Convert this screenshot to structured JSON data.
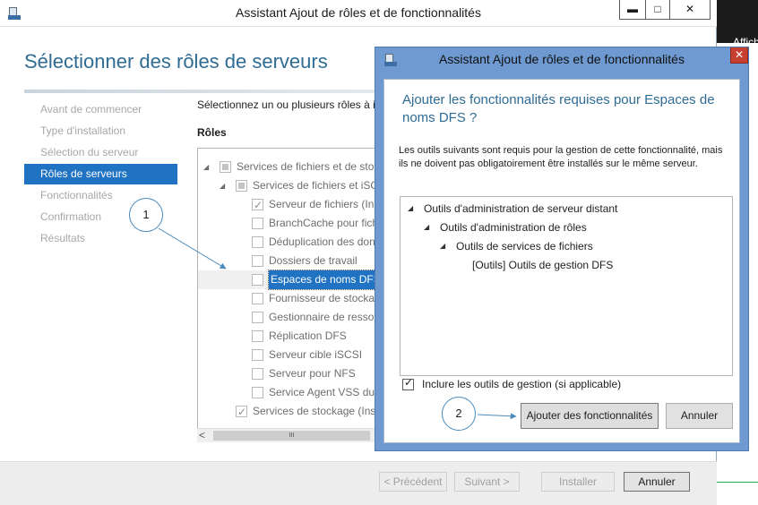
{
  "main_window": {
    "title": "Assistant Ajout de rôles et de fonctionnalités",
    "heading": "Sélectionner des rôles de serveurs",
    "nav": [
      {
        "label": "Avant de commencer",
        "active": false
      },
      {
        "label": "Type d'installation",
        "active": false
      },
      {
        "label": "Sélection du serveur",
        "active": false
      },
      {
        "label": "Rôles de serveurs",
        "active": true
      },
      {
        "label": "Fonctionnalités",
        "active": false
      },
      {
        "label": "Confirmation",
        "active": false
      },
      {
        "label": "Résultats",
        "active": false
      }
    ],
    "instruction": "Sélectionnez un ou plusieurs rôles à i",
    "roles_label": "Rôles",
    "roles_tree": [
      {
        "label": "Services de fichiers et de stoc",
        "state": "partial",
        "expander": "◢"
      },
      {
        "label": "Services de fichiers et iSCSI",
        "state": "partial",
        "expander": "◢"
      },
      {
        "label": "Serveur de fichiers (Ins",
        "state": "checked",
        "expander": ""
      },
      {
        "label": "BranchCache pour fich",
        "state": "unchecked",
        "expander": ""
      },
      {
        "label": "Déduplication des don",
        "state": "unchecked",
        "expander": ""
      },
      {
        "label": "Dossiers de travail",
        "state": "unchecked",
        "expander": ""
      },
      {
        "label": "Espaces de noms DFS",
        "state": "unchecked",
        "expander": "",
        "selected": true
      },
      {
        "label": "Fournisseur de stockag",
        "state": "unchecked",
        "expander": ""
      },
      {
        "label": "Gestionnaire de ressou",
        "state": "unchecked",
        "expander": ""
      },
      {
        "label": "Réplication DFS",
        "state": "unchecked",
        "expander": ""
      },
      {
        "label": "Serveur cible iSCSI",
        "state": "unchecked",
        "expander": ""
      },
      {
        "label": "Serveur pour NFS",
        "state": "unchecked",
        "expander": ""
      },
      {
        "label": "Service Agent VSS du",
        "state": "unchecked",
        "expander": ""
      },
      {
        "label": "Services de stockage (Inst",
        "state": "checked",
        "expander": ""
      }
    ],
    "scroll_left": "<",
    "scroll_thumb": "III",
    "buttons": {
      "previous": "< Précédent",
      "next": "Suivant >",
      "install": "Installer",
      "cancel": "Annuler"
    },
    "window_controls": {
      "minimize": "▬",
      "maximize": "□",
      "close": "✕"
    }
  },
  "background_window": {
    "text": "Affich"
  },
  "dialog": {
    "title": "Assistant Ajout de rôles et de fonctionnalités",
    "close": "✕",
    "heading": "Ajouter les fonctionnalités requises pour Espaces de noms DFS ?",
    "description": "Les outils suivants sont requis pour la gestion de cette fonctionnalité, mais ils ne doivent pas obligatoirement être installés sur le même serveur.",
    "tree": [
      {
        "label": "Outils d'administration de serveur distant",
        "level": 0,
        "expander": "◢"
      },
      {
        "label": "Outils d'administration de rôles",
        "level": 1,
        "expander": "◢"
      },
      {
        "label": "Outils de services de fichiers",
        "level": 2,
        "expander": "◢"
      },
      {
        "label": "[Outils] Outils de gestion DFS",
        "level": 3,
        "expander": ""
      }
    ],
    "include_tools": "Inclure les outils de gestion (si applicable)",
    "include_checked": true,
    "add_button": "Ajouter des fonctionnalités",
    "cancel_button": "Annuler"
  },
  "callouts": {
    "one": "1",
    "two": "2"
  }
}
